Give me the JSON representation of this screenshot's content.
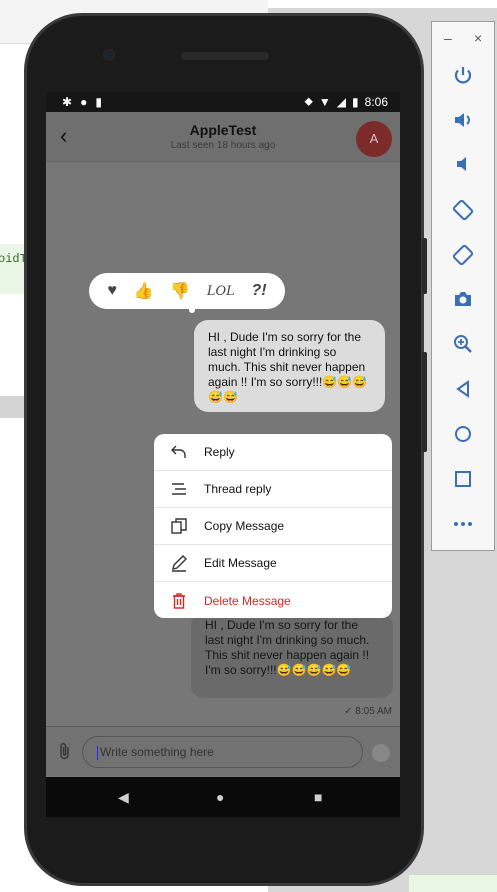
{
  "background": {
    "left_chip_text": "oidT"
  },
  "toolbar": {
    "minimize": "–",
    "close": "×",
    "buttons": [
      "power-icon",
      "volume-up-icon",
      "volume-down-icon",
      "rotate-left-icon",
      "rotate-right-icon",
      "camera-icon",
      "zoom-icon",
      "back-icon",
      "home-icon",
      "overview-icon",
      "more-icon"
    ]
  },
  "status_bar": {
    "time": "8:06"
  },
  "chat": {
    "title": "AppleTest",
    "subtitle": "Last seen 18 hours ago",
    "avatar_letter": "A"
  },
  "reactions": {
    "lol": "LOL",
    "question": "?!"
  },
  "focused_message": {
    "text": "HI , Dude I'm so sorry for the last night I'm drinking so much. This shit never happen again !! I'm so sorry!!!😅😅😅😅😅"
  },
  "menu": {
    "items": [
      {
        "label": "Reply",
        "icon": "reply-icon"
      },
      {
        "label": "Thread reply",
        "icon": "thread-icon"
      },
      {
        "label": "Copy Message",
        "icon": "copy-icon"
      },
      {
        "label": "Edit Message",
        "icon": "edit-icon"
      },
      {
        "label": "Delete Message",
        "icon": "trash-icon"
      }
    ],
    "danger_color": "#e02424"
  },
  "background_message": {
    "text": "HI , Dude I'm so sorry for the last night I'm drinking so much. This shit never happen again !! I'm so sorry!!!😅😅😅😅😅",
    "time": "✓ 8:05 AM"
  },
  "composer": {
    "placeholder": "Write something here"
  }
}
